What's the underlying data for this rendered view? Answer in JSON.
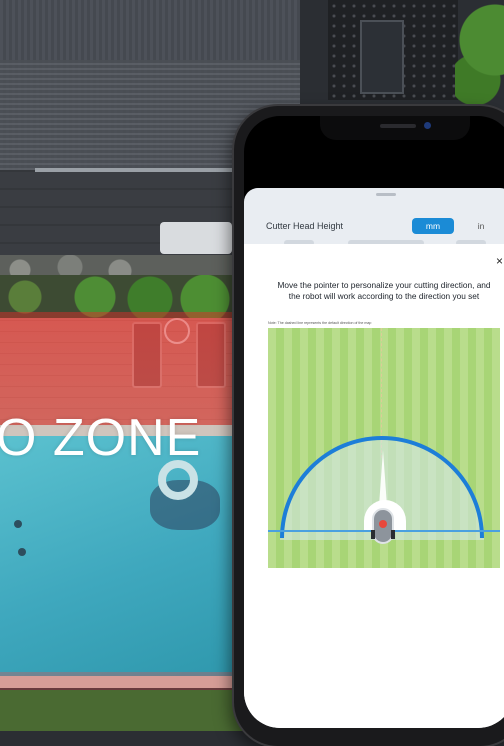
{
  "banner": {
    "zone_text": "O ZONE"
  },
  "app": {
    "cutter_head_height_label": "Cutter Head Height",
    "units": {
      "selected": "mm",
      "options": [
        "mm",
        "in"
      ]
    },
    "dialog": {
      "close_glyph": "×",
      "instruction_line1": "Move the pointer to personalize your cutting direction, and",
      "instruction_line2": "the robot will work according to the direction you set",
      "note": "Note: The dashed line represents the default direction of the map"
    }
  },
  "colors": {
    "accent": "#1b8bd6",
    "arc": "#1d7ed8",
    "lawn_light": "#b9dd8c",
    "lawn_dark": "#a8d576",
    "no_zone_tint": "#e62828"
  }
}
